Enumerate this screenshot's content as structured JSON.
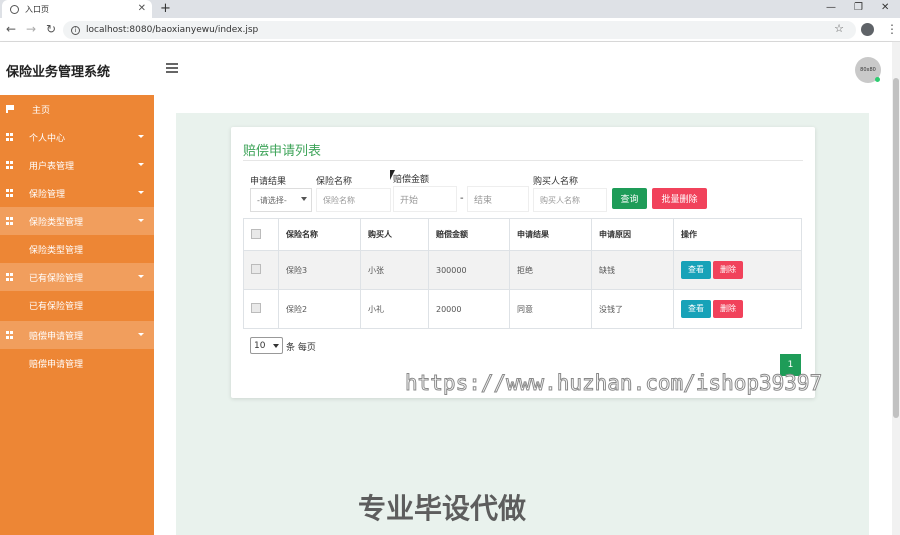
{
  "browser": {
    "tab_title": "入口页",
    "url": "localhost:8080/baoxianyewu/index.jsp"
  },
  "app": {
    "title": "保险业务管理系统",
    "avatar_label": "80x80"
  },
  "sidebar": {
    "items": [
      {
        "label": "主页",
        "icon": "flag-icon"
      },
      {
        "label": "个人中心",
        "icon": "grid-icon"
      },
      {
        "label": "用户表管理",
        "icon": "grid-icon"
      },
      {
        "label": "保险管理",
        "icon": "grid-icon"
      },
      {
        "label": "保险类型管理",
        "icon": "grid-icon"
      },
      {
        "label": "保险类型管理"
      },
      {
        "label": "已有保险管理",
        "icon": "grid-icon"
      },
      {
        "label": "已有保险管理"
      },
      {
        "label": "赔偿申请管理",
        "icon": "grid-icon"
      },
      {
        "label": "赔偿申请管理"
      }
    ]
  },
  "page": {
    "title": "赔偿申请列表"
  },
  "filters": {
    "result_label": "申请结果",
    "result_value": "-请选择-",
    "insurance_label": "保险名称",
    "insurance_placeholder": "保险名称",
    "amount_label": "赔偿金额",
    "amount_start_placeholder": "开始",
    "amount_separator": "-",
    "amount_end_placeholder": "结束",
    "buyer_label": "购买人名称",
    "buyer_placeholder": "购买人名称",
    "search_button": "查询",
    "batch_delete_button": "批量删除"
  },
  "table": {
    "headers": [
      "",
      "保险名称",
      "购买人",
      "赔偿金额",
      "申请结果",
      "申请原因",
      "操作"
    ],
    "rows": [
      {
        "name": "保险3",
        "buyer": "小张",
        "amount": "300000",
        "result": "拒绝",
        "reason": "缺钱"
      },
      {
        "name": "保险2",
        "buyer": "小礼",
        "amount": "20000",
        "result": "同意",
        "reason": "没钱了"
      }
    ],
    "view_button": "查看",
    "delete_button": "删除"
  },
  "pagination": {
    "page_size": "10",
    "per_page_text": "条 每页",
    "current_page": "1"
  },
  "watermark": {
    "url": "https://www.huzhan.com/ishop39397",
    "text": "专业毕设代做"
  },
  "colors": {
    "sidebar": "#ed8635",
    "accent_green": "#1e9c58",
    "danger_red": "#f1425b",
    "info_teal": "#17a2b8"
  }
}
